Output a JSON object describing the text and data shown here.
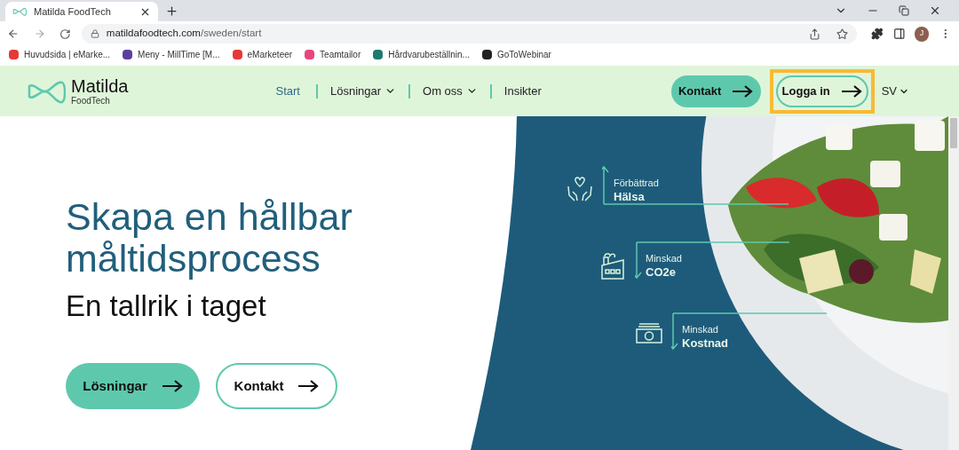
{
  "browser": {
    "tab": {
      "title": "Matilda FoodTech",
      "selected": true
    },
    "url": {
      "domain": "matildafoodtech.com",
      "path": "/sweden/start"
    },
    "profile_initial": "J",
    "bookmarks": [
      {
        "label": "Huvudsida | eMarke...",
        "color": "#e53935"
      },
      {
        "label": "Meny - MillTime [M...",
        "color": "#5b3f9e"
      },
      {
        "label": "eMarketeer",
        "color": "#e53935"
      },
      {
        "label": "Teamtailor",
        "color": "#e8467c"
      },
      {
        "label": "Hårdvarubeställnin...",
        "color": "#1e7a6e"
      },
      {
        "label": "GoToWebinar",
        "color": "#222222"
      }
    ]
  },
  "nav": {
    "logo": {
      "name": "Matilda",
      "sub": "FoodTech"
    },
    "links": [
      {
        "label": "Start",
        "selected": true,
        "dropdown": false
      },
      {
        "label": "Lösningar",
        "selected": false,
        "dropdown": true
      },
      {
        "label": "Om oss",
        "selected": false,
        "dropdown": true
      },
      {
        "label": "Insikter",
        "selected": false,
        "dropdown": false
      }
    ],
    "buttons": [
      {
        "label": "Kontakt",
        "kind": "filled",
        "highlighted": false
      },
      {
        "label": "Logga in",
        "kind": "outline",
        "highlighted": true
      }
    ],
    "language": "SV"
  },
  "hero": {
    "title": "Skapa en hållbar måltidsprocess",
    "subtitle": "En tallrik i taget",
    "buttons": [
      {
        "label": "Lösningar",
        "kind": "filled"
      },
      {
        "label": "Kontakt",
        "kind": "outline"
      }
    ],
    "benefits": [
      {
        "kind": "health",
        "rising": true,
        "label": "Förbättrad",
        "value": "Hälsa"
      },
      {
        "kind": "factory",
        "rising": false,
        "label": "Minskad",
        "value": "CO2e"
      },
      {
        "kind": "money",
        "rising": false,
        "label": "Minskad",
        "value": "Kostnad"
      }
    ]
  }
}
